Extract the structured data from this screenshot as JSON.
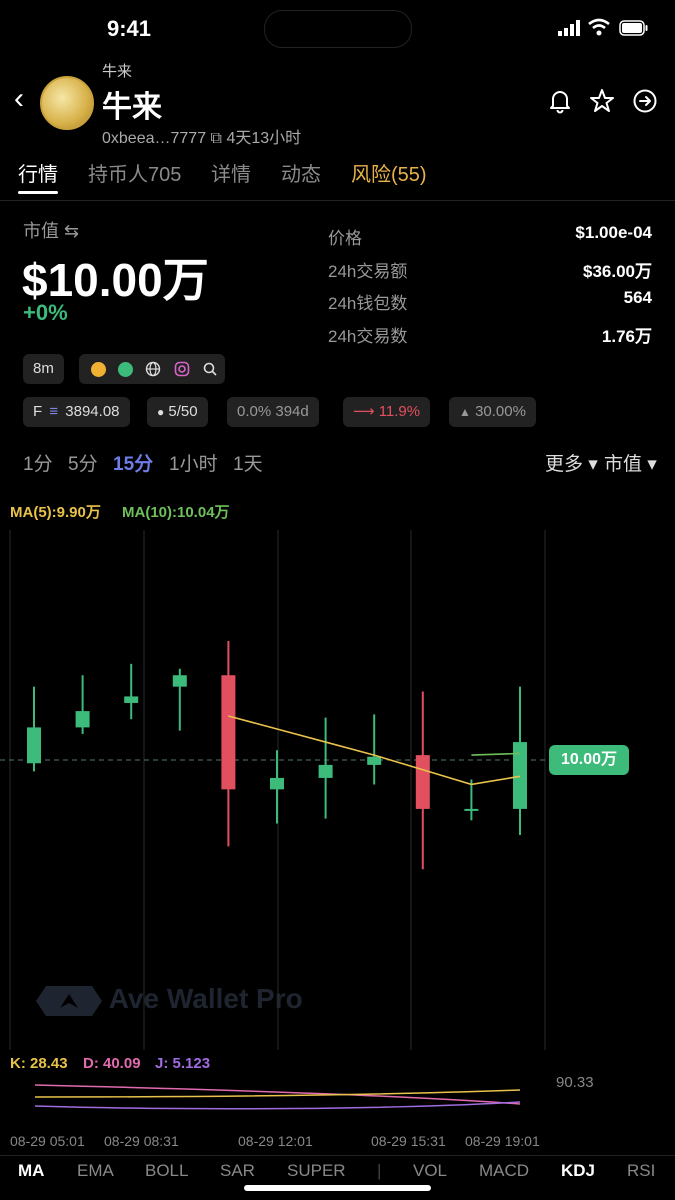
{
  "status": {
    "time": "9:41"
  },
  "header": {
    "small_name": "牛来",
    "name": "牛来",
    "address": "0xbeea…7777",
    "copy_icon": "⧉",
    "age": "4天13小时"
  },
  "tabs": [
    {
      "label": "行情"
    },
    {
      "label": "持币人705"
    },
    {
      "label": "详情"
    },
    {
      "label": "动态"
    },
    {
      "label": "风险(55)"
    }
  ],
  "summary": {
    "mcap_label": "市值",
    "swap_icon": "⇆",
    "mcap_value": "$10.00万",
    "change": "+0%",
    "stats": [
      {
        "label": "价格",
        "value": "$1.00e-04"
      },
      {
        "label": "24h交易额",
        "value": "$36.00万"
      },
      {
        "label": "24h钱包数",
        "value": "564"
      },
      {
        "label": "24h交易数",
        "value": "1.76万"
      }
    ]
  },
  "chips": {
    "age": "8m",
    "f_label": "F",
    "f_icon": "≡",
    "f_value": "3894.08",
    "holders_icon": "●",
    "holders": "5/50",
    "tax": "0.0%",
    "days": "394d",
    "trend_icon": "⟶",
    "trend": "11.9%",
    "top_icon": "▲",
    "top": "30.00%"
  },
  "timeframes": {
    "options": [
      "1分",
      "5分",
      "15分",
      "1小时",
      "1天"
    ],
    "active": "15分",
    "more": "更多 ▾",
    "metric": "市值 ▾"
  },
  "chart_labels": {
    "ma5": "MA(5):9.90万",
    "ma10": "MA(10):10.04万",
    "current_tag": "10.00万",
    "watermark": "Ave Wallet Pro",
    "kdj_k": "K: 28.43",
    "kdj_d": "D: 40.09",
    "kdj_j": "J: 5.123",
    "kdj_scale": "90.33",
    "time_ticks": [
      "08-29 05:01",
      "08-29 08:31",
      "08-29 12:01",
      "08-29 15:31",
      "08-29 19:01"
    ]
  },
  "chart_data": {
    "type": "candlestick",
    "current_value": 10.0,
    "candles": [
      {
        "o": 9.98,
        "c": 10.2,
        "h": 10.45,
        "l": 9.93
      },
      {
        "o": 10.2,
        "c": 10.3,
        "h": 10.52,
        "l": 10.16
      },
      {
        "o": 10.35,
        "c": 10.39,
        "h": 10.59,
        "l": 10.25
      },
      {
        "o": 10.45,
        "c": 10.52,
        "h": 10.56,
        "l": 10.18
      },
      {
        "o": 10.52,
        "c": 9.82,
        "h": 10.73,
        "l": 9.47
      },
      {
        "o": 9.82,
        "c": 9.89,
        "h": 10.06,
        "l": 9.61
      },
      {
        "o": 9.89,
        "c": 9.97,
        "h": 10.26,
        "l": 9.64
      },
      {
        "o": 9.97,
        "c": 10.02,
        "h": 10.28,
        "l": 9.85
      },
      {
        "o": 10.03,
        "c": 9.7,
        "h": 10.42,
        "l": 9.33
      },
      {
        "o": 9.7,
        "c": 9.7,
        "h": 9.88,
        "l": 9.63
      },
      {
        "o": 9.7,
        "c": 10.11,
        "h": 10.45,
        "l": 9.54
      }
    ],
    "ma5": [
      null,
      null,
      null,
      null,
      10.27,
      10.19,
      10.11,
      10.03,
      9.94,
      9.85,
      9.9
    ],
    "ma10": [
      null,
      null,
      null,
      null,
      null,
      null,
      null,
      null,
      null,
      10.03,
      10.04
    ],
    "colors": {
      "up": "#3dbb7b",
      "down": "#e2505f",
      "ma5": "#e8c24a",
      "ma10": "#6fbf5a"
    }
  },
  "indicators": [
    {
      "label": "MA",
      "on": true
    },
    {
      "label": "EMA",
      "on": false
    },
    {
      "label": "BOLL",
      "on": false
    },
    {
      "label": "SAR",
      "on": false
    },
    {
      "label": "SUPER",
      "on": false
    },
    {
      "label": "|",
      "on": false
    },
    {
      "label": "VOL",
      "on": false
    },
    {
      "label": "MACD",
      "on": false
    },
    {
      "label": "KDJ",
      "on": true
    },
    {
      "label": "RSI",
      "on": false
    }
  ]
}
